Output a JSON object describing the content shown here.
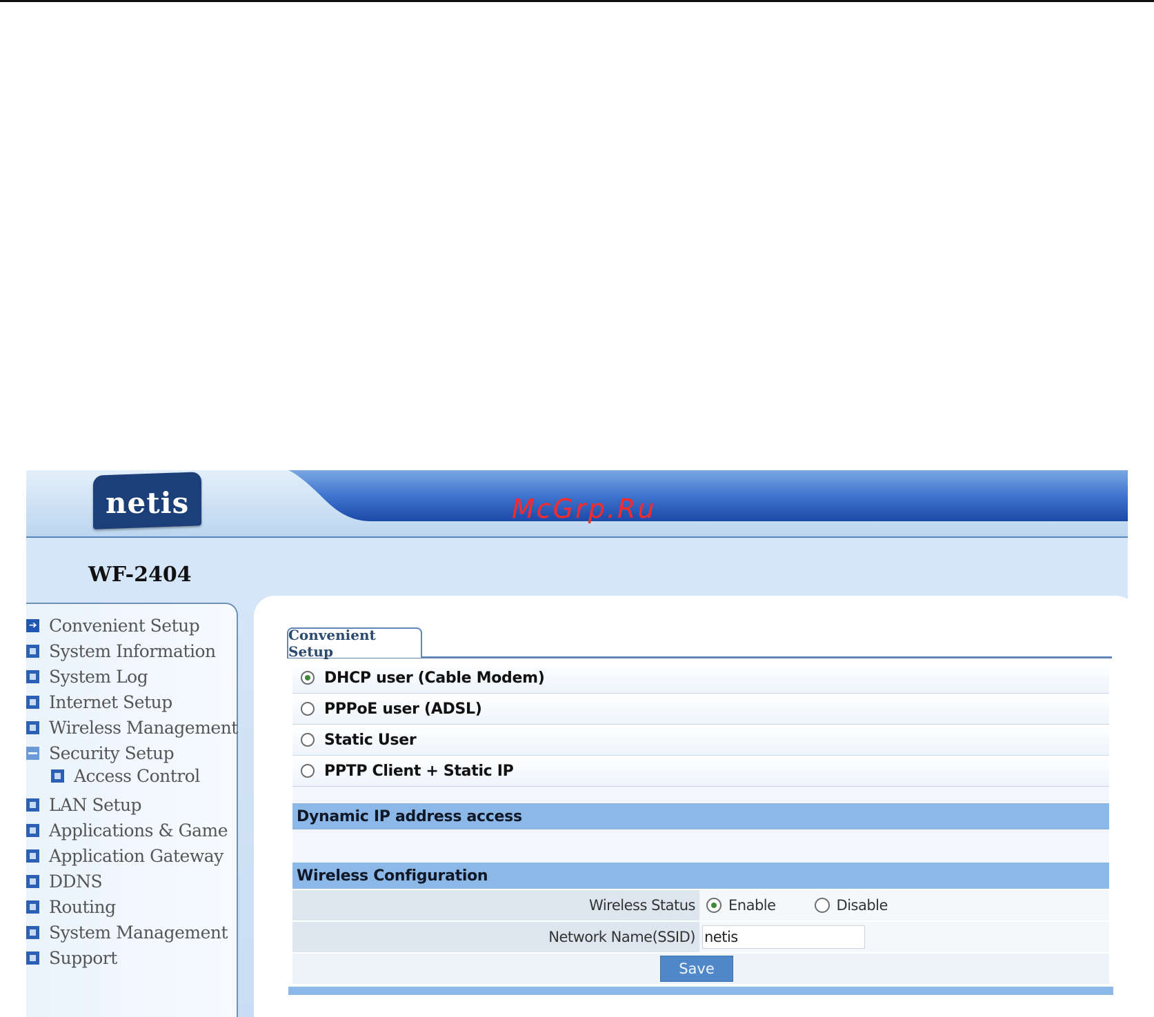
{
  "header": {
    "logo_text": "netis",
    "watermark": "McGrp.Ru",
    "model": "WF-2404"
  },
  "sidebar": {
    "items": [
      {
        "label": "Convenient Setup",
        "icon": "arrow-right-icon",
        "active": true
      },
      {
        "label": "System Information",
        "icon": "square-icon"
      },
      {
        "label": "System Log",
        "icon": "square-icon"
      },
      {
        "label": "Internet Setup",
        "icon": "square-icon"
      },
      {
        "label": "Wireless Management",
        "icon": "square-icon"
      },
      {
        "label": "Security Setup",
        "icon": "minus-icon",
        "expanded": true
      },
      {
        "label": "Access Control",
        "icon": "square-icon",
        "sub": true
      },
      {
        "label": "LAN Setup",
        "icon": "square-icon"
      },
      {
        "label": "Applications & Game",
        "icon": "square-icon"
      },
      {
        "label": "Application Gateway",
        "icon": "square-icon"
      },
      {
        "label": "DDNS",
        "icon": "square-icon"
      },
      {
        "label": "Routing",
        "icon": "square-icon"
      },
      {
        "label": "System Management",
        "icon": "square-icon"
      },
      {
        "label": "Support",
        "icon": "square-icon"
      }
    ]
  },
  "main": {
    "tab_label": "Convenient Setup",
    "connection_options": [
      {
        "label": "DHCP user (Cable Modem)",
        "selected": true
      },
      {
        "label": "PPPoE user (ADSL)",
        "selected": false
      },
      {
        "label": "Static User",
        "selected": false
      },
      {
        "label": "PPTP Client + Static IP",
        "selected": false
      }
    ],
    "dynamic_section_title": "Dynamic IP address access",
    "wireless_section_title": "Wireless Configuration",
    "wireless_status": {
      "label": "Wireless Status",
      "enable_label": "Enable",
      "disable_label": "Disable",
      "value": "Enable"
    },
    "ssid": {
      "label": "Network Name(SSID)",
      "value": "netis"
    },
    "save_label": "Save"
  },
  "colors": {
    "header_blue": "#1f4fae",
    "section_bar": "#8bb8e6",
    "logo_bg": "#1c3f7a",
    "watermark": "#ff2a2a",
    "radio_selected": "#3f8a3a"
  }
}
